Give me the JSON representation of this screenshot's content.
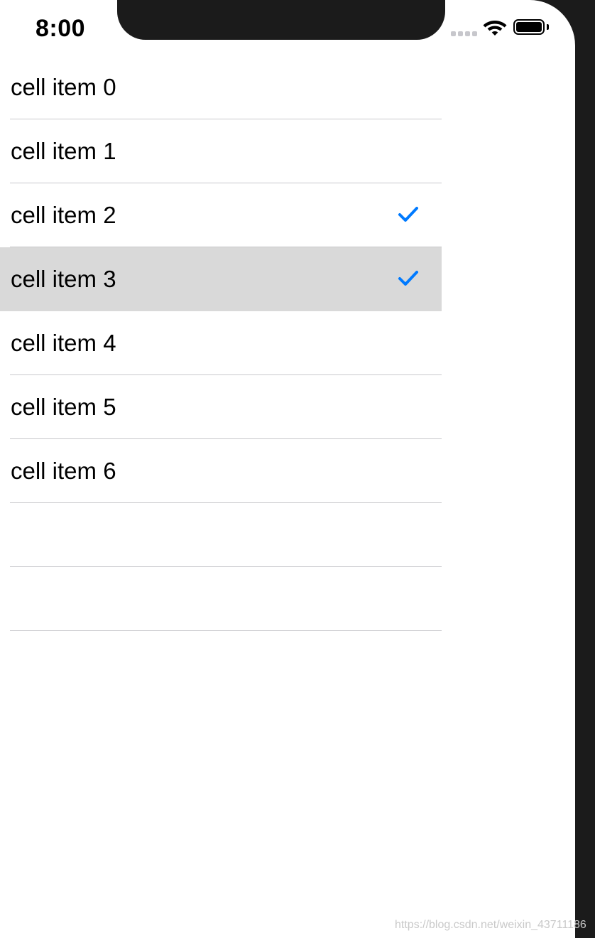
{
  "status_bar": {
    "time": "8:00",
    "signal_icon": "cellular-signal-icon",
    "wifi_icon": "wifi-icon",
    "battery_icon": "battery-full-icon"
  },
  "table": {
    "cells": [
      {
        "label": "cell item 0",
        "checked": false,
        "selected": false
      },
      {
        "label": "cell item 1",
        "checked": false,
        "selected": false
      },
      {
        "label": "cell item 2",
        "checked": true,
        "selected": false
      },
      {
        "label": "cell item 3",
        "checked": true,
        "selected": true
      },
      {
        "label": "cell item 4",
        "checked": false,
        "selected": false
      },
      {
        "label": "cell item 5",
        "checked": false,
        "selected": false
      },
      {
        "label": "cell item 6",
        "checked": false,
        "selected": false
      },
      {
        "label": "",
        "checked": false,
        "selected": false
      },
      {
        "label": "",
        "checked": false,
        "selected": false
      }
    ],
    "checkmark_icon": "checkmark-icon",
    "accent_color": "#007aff",
    "selected_color": "#d9d9d9"
  },
  "watermark": "https://blog.csdn.net/weixin_43711186"
}
